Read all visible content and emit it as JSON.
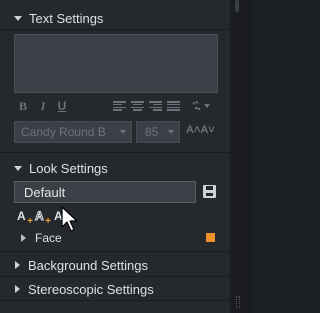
{
  "text_settings": {
    "title": "Text Settings",
    "text_value": "",
    "format": {
      "bold": "B",
      "italic": "I",
      "underline": "U"
    },
    "font": "Candy Round B",
    "size": "85",
    "grow_shrink_label": "A˄A˅"
  },
  "look_settings": {
    "title": "Look Settings",
    "preset": "Default",
    "icons": [
      {
        "glyph": "A",
        "name": "add-shadow-icon"
      },
      {
        "glyph": "A",
        "name": "add-edge-icon"
      },
      {
        "glyph": "A",
        "name": "add-face-icon"
      }
    ],
    "face_label": "Face",
    "face_color": "#f0902a"
  },
  "background_settings": {
    "title": "Background Settings"
  },
  "stereoscopic_settings": {
    "title": "Stereoscopic Settings"
  }
}
